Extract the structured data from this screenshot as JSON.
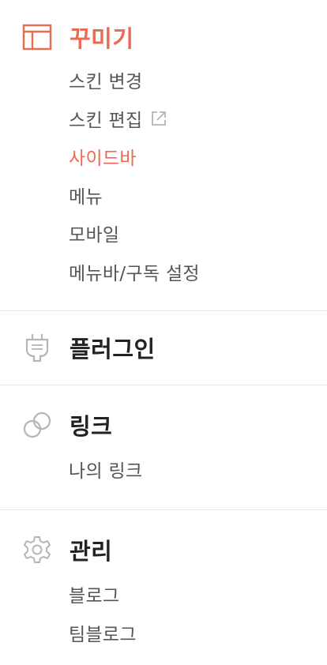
{
  "sections": [
    {
      "id": "decorate",
      "title": "꾸미기",
      "icon": "layout-icon",
      "items": [
        {
          "label": "스킨 변경"
        },
        {
          "label": "스킨 편집"
        },
        {
          "label": "사이드바"
        },
        {
          "label": "메뉴"
        },
        {
          "label": "모바일"
        },
        {
          "label": "메뉴바/구독 설정"
        }
      ]
    },
    {
      "id": "plugin",
      "title": "플러그인",
      "icon": "plug-icon",
      "items": []
    },
    {
      "id": "link",
      "title": "링크",
      "icon": "link-icon",
      "items": [
        {
          "label": "나의 링크"
        }
      ]
    },
    {
      "id": "manage",
      "title": "관리",
      "icon": "gear-icon",
      "items": [
        {
          "label": "블로그"
        },
        {
          "label": "팀블로그"
        }
      ]
    }
  ],
  "colors": {
    "accent": "#ec6a52",
    "text": "#222222",
    "subtext": "#555555",
    "icon": "#b5b5b5",
    "divider": "#e6e6e6"
  }
}
